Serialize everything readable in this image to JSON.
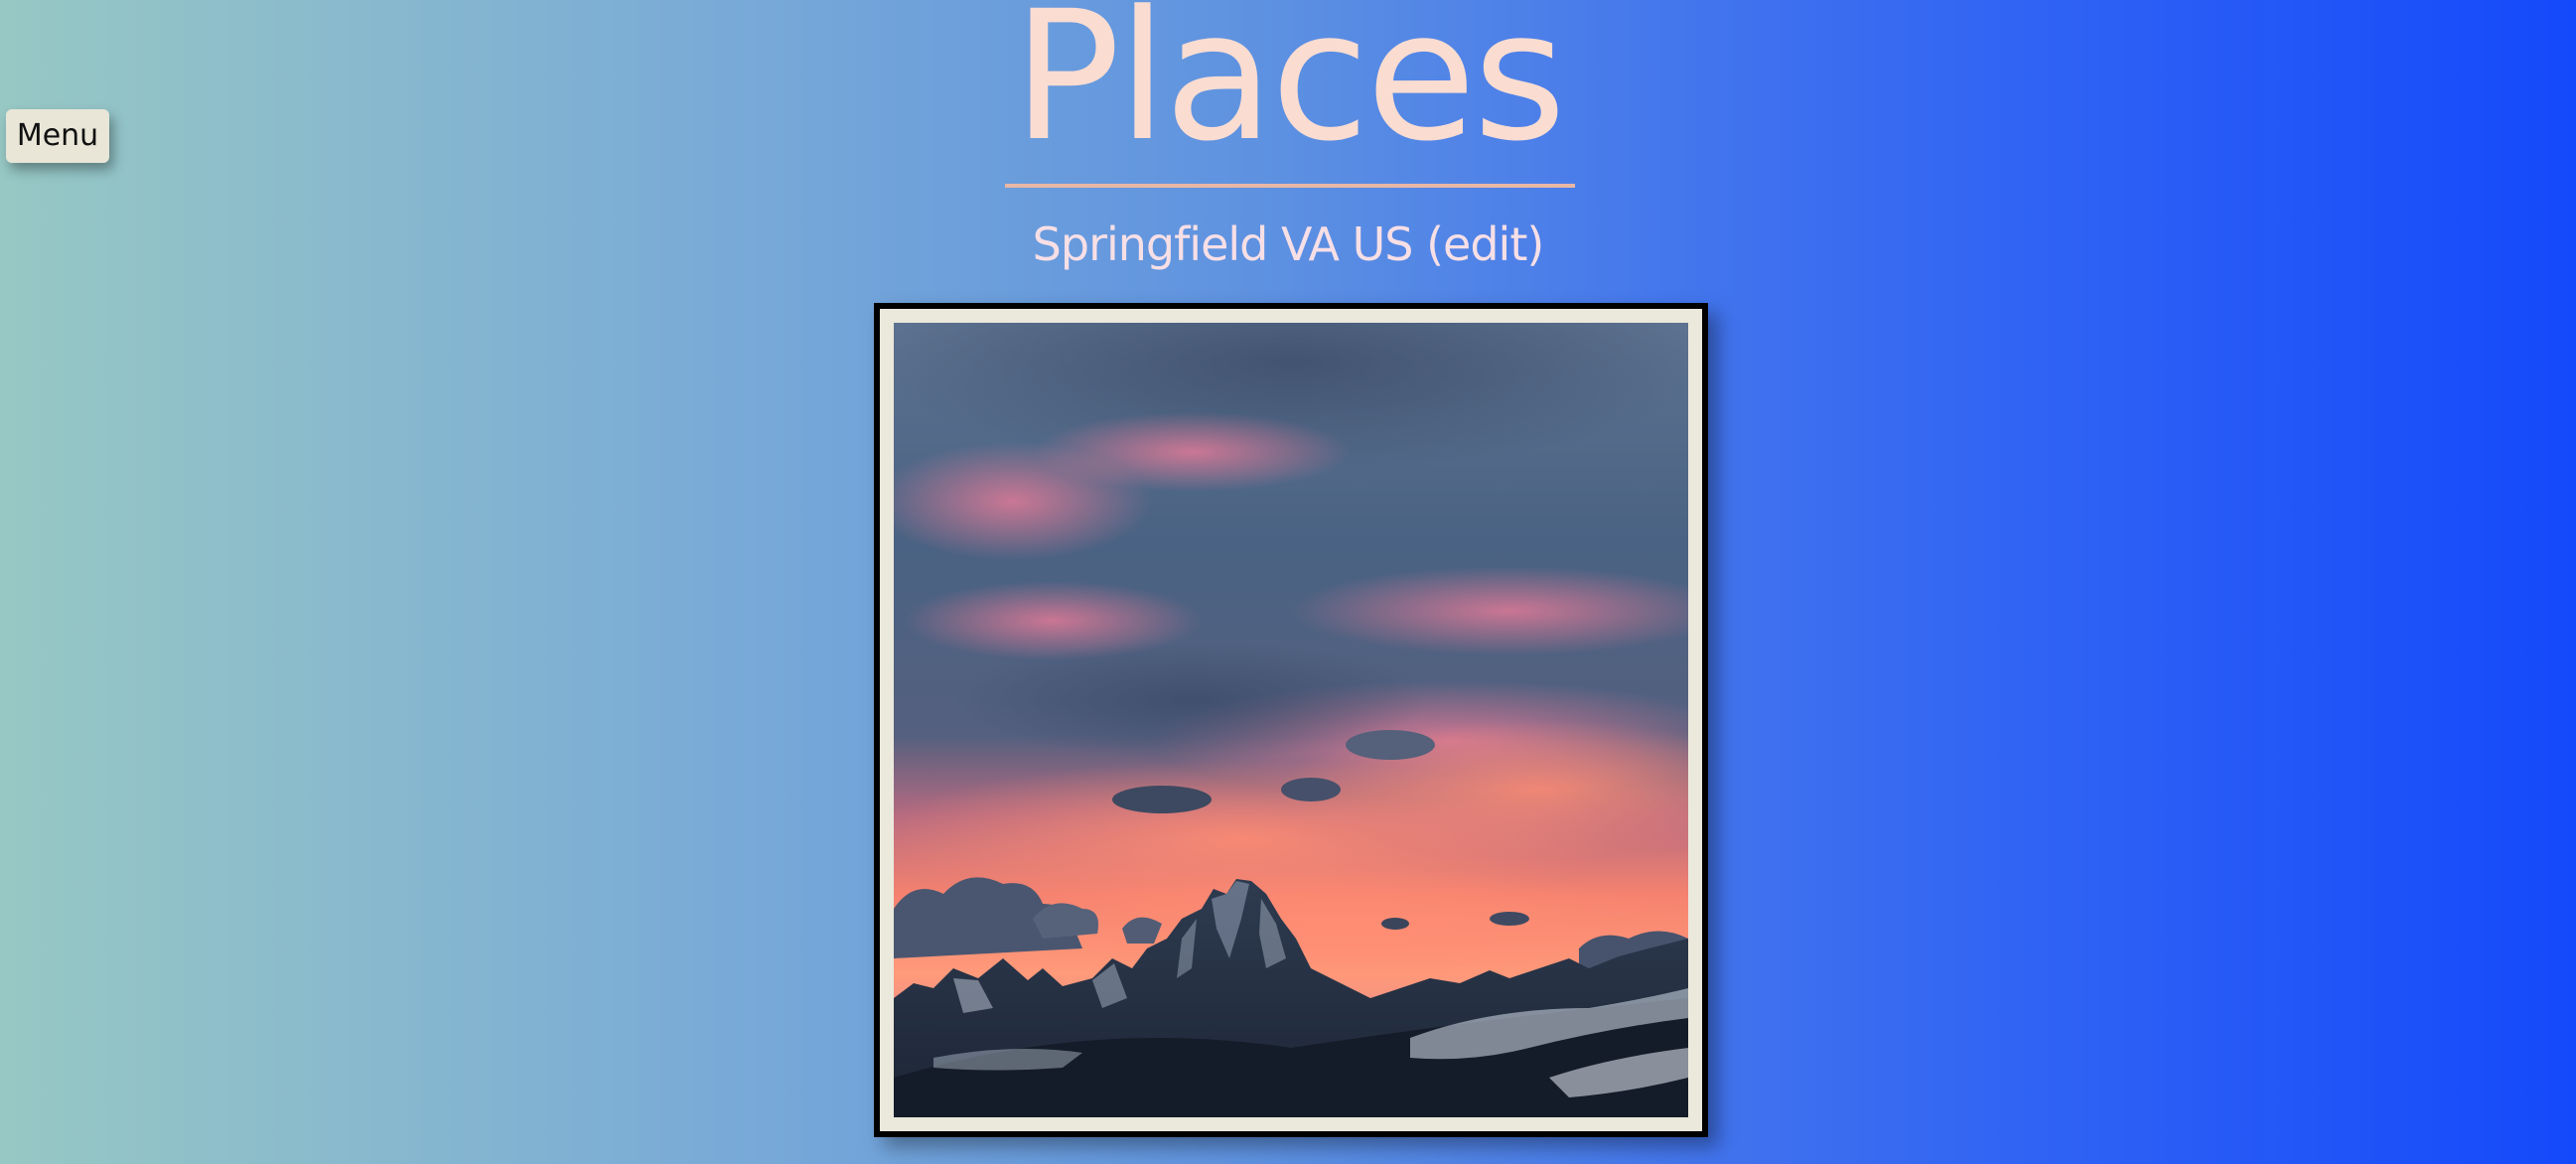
{
  "nav": {
    "menu_label": "Menu"
  },
  "header": {
    "title": "Places",
    "location": "Springfield VA US",
    "edit_label": "(edit)"
  },
  "colors": {
    "title": "#fadcd1",
    "subtitle": "#f7dfe6",
    "rule": "#e8b7a5",
    "menu_background": "#e9e6d7",
    "frame_border": "#000000",
    "frame_mat": "#ebe8dc",
    "gradient_start": "#97c8c4",
    "gradient_end": "#1449fb"
  },
  "photo": {
    "subject": "mountain-sunset-photo"
  }
}
